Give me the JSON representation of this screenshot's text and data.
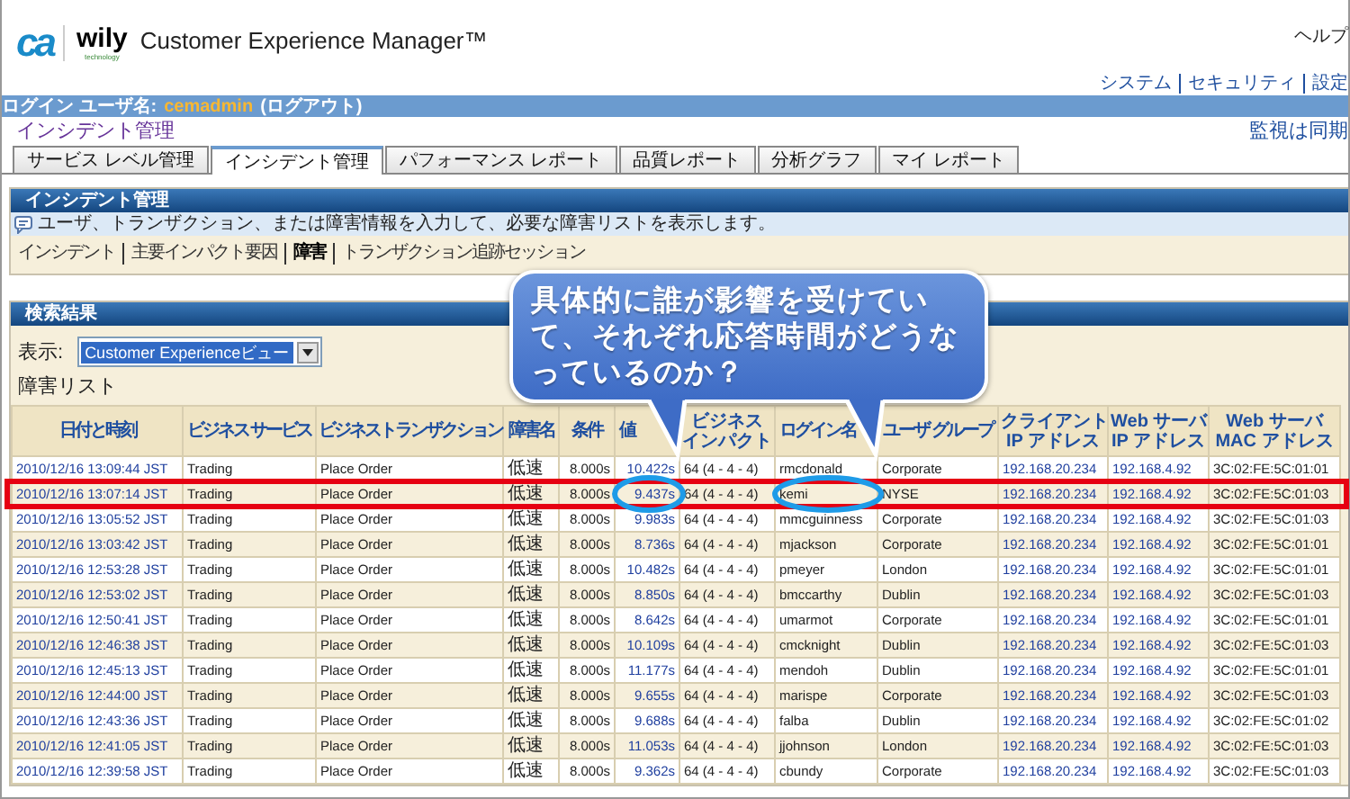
{
  "header": {
    "logo_mark": "ca",
    "logo_word": "wily",
    "logo_tagline": "technology",
    "product": "Customer Experience Manager™",
    "help_link": "ヘルプ",
    "links": [
      "システム",
      "セキュリティ",
      "設定"
    ]
  },
  "login_bar": {
    "label": "ログイン ユーザ名:",
    "user": "cemadmin",
    "logout": "(ログアウト)"
  },
  "page_title": "インシデント管理",
  "sync_status": "監視は同期",
  "tabs": [
    {
      "label": "サービス レベル管理",
      "selected": false
    },
    {
      "label": "インシデント管理",
      "selected": true
    },
    {
      "label": "パフォーマンス レポート",
      "selected": false
    },
    {
      "label": "品質レポート",
      "selected": false
    },
    {
      "label": "分析グラフ",
      "selected": false
    },
    {
      "label": "マイ レポート",
      "selected": false
    }
  ],
  "incident_section": {
    "title": "インシデント管理",
    "info": "ユーザ、トランザクション、または障害情報を入力して、必要な障害リストを表示します。",
    "links": [
      {
        "label": "インシデント",
        "selected": false
      },
      {
        "label": "主要インパクト要因",
        "selected": false
      },
      {
        "label": "障害",
        "selected": true
      },
      {
        "label": "トランザクション追跡セッション",
        "selected": false
      }
    ]
  },
  "results_section": {
    "title": "検索結果",
    "view_label": "表示:",
    "view_value": "Customer Experienceビュー",
    "list_title": "障害リスト"
  },
  "table": {
    "columns": [
      {
        "label": "日付と時刻",
        "kind": "link",
        "circled": false
      },
      {
        "label": "ビジネス サービス",
        "kind": "text",
        "circled": false
      },
      {
        "label": "ビジネストランザクション",
        "kind": "text",
        "circled": false
      },
      {
        "label": "障害名",
        "kind": "text",
        "circled": false
      },
      {
        "label": "条件",
        "kind": "text",
        "circled": false
      },
      {
        "label": "値",
        "kind": "link",
        "circled": true
      },
      {
        "label_lines": [
          "ビジネス",
          "インパクト"
        ],
        "kind": "text",
        "circled": false
      },
      {
        "label": "ログイン名",
        "kind": "text",
        "circled": true
      },
      {
        "label": "ユーザ グループ",
        "kind": "text",
        "circled": false
      },
      {
        "label_lines": [
          "クライアント",
          "IP アドレス"
        ],
        "kind": "link",
        "circled": false
      },
      {
        "label_lines": [
          "Web サーバ",
          "IP アドレス"
        ],
        "kind": "link",
        "circled": false
      },
      {
        "label_lines": [
          "Web サーバ",
          "MAC アドレス"
        ],
        "kind": "text",
        "circled": false
      }
    ],
    "rows": [
      {
        "highlighted": false,
        "cells": [
          "2010/12/16 13:09:44 JST",
          "Trading",
          "Place Order",
          "低速",
          "8.000s",
          "10.422s",
          "64 (4 - 4 - 4)",
          "rmcdonald",
          "Corporate",
          "192.168.20.234",
          "192.168.4.92",
          "3C:02:FE:5C:01:01"
        ]
      },
      {
        "highlighted": true,
        "cells": [
          "2010/12/16 13:07:14 JST",
          "Trading",
          "Place Order",
          "低速",
          "8.000s",
          "9.437s",
          "64 (4 - 4 - 4)",
          "kemi",
          "NYSE",
          "192.168.20.234",
          "192.168.4.92",
          "3C:02:FE:5C:01:03"
        ]
      },
      {
        "highlighted": false,
        "cells": [
          "2010/12/16 13:05:52 JST",
          "Trading",
          "Place Order",
          "低速",
          "8.000s",
          "9.983s",
          "64 (4 - 4 - 4)",
          "mmcguinness",
          "Corporate",
          "192.168.20.234",
          "192.168.4.92",
          "3C:02:FE:5C:01:03"
        ]
      },
      {
        "highlighted": false,
        "cells": [
          "2010/12/16 13:03:42 JST",
          "Trading",
          "Place Order",
          "低速",
          "8.000s",
          "8.736s",
          "64 (4 - 4 - 4)",
          "mjackson",
          "Corporate",
          "192.168.20.234",
          "192.168.4.92",
          "3C:02:FE:5C:01:01"
        ]
      },
      {
        "highlighted": false,
        "cells": [
          "2010/12/16 12:53:28 JST",
          "Trading",
          "Place Order",
          "低速",
          "8.000s",
          "10.482s",
          "64 (4 - 4 - 4)",
          "pmeyer",
          "London",
          "192.168.20.234",
          "192.168.4.92",
          "3C:02:FE:5C:01:01"
        ]
      },
      {
        "highlighted": false,
        "cells": [
          "2010/12/16 12:53:02 JST",
          "Trading",
          "Place Order",
          "低速",
          "8.000s",
          "8.850s",
          "64 (4 - 4 - 4)",
          "bmccarthy",
          "Dublin",
          "192.168.20.234",
          "192.168.4.92",
          "3C:02:FE:5C:01:03"
        ]
      },
      {
        "highlighted": false,
        "cells": [
          "2010/12/16 12:50:41 JST",
          "Trading",
          "Place Order",
          "低速",
          "8.000s",
          "8.642s",
          "64 (4 - 4 - 4)",
          "umarmot",
          "Corporate",
          "192.168.20.234",
          "192.168.4.92",
          "3C:02:FE:5C:01:01"
        ]
      },
      {
        "highlighted": false,
        "cells": [
          "2010/12/16 12:46:38 JST",
          "Trading",
          "Place Order",
          "低速",
          "8.000s",
          "10.109s",
          "64 (4 - 4 - 4)",
          "cmcknight",
          "Dublin",
          "192.168.20.234",
          "192.168.4.92",
          "3C:02:FE:5C:01:03"
        ]
      },
      {
        "highlighted": false,
        "cells": [
          "2010/12/16 12:45:13 JST",
          "Trading",
          "Place Order",
          "低速",
          "8.000s",
          "11.177s",
          "64 (4 - 4 - 4)",
          "mendoh",
          "Dublin",
          "192.168.20.234",
          "192.168.4.92",
          "3C:02:FE:5C:01:01"
        ]
      },
      {
        "highlighted": false,
        "cells": [
          "2010/12/16 12:44:00 JST",
          "Trading",
          "Place Order",
          "低速",
          "8.000s",
          "9.655s",
          "64 (4 - 4 - 4)",
          "marispe",
          "Corporate",
          "192.168.20.234",
          "192.168.4.92",
          "3C:02:FE:5C:01:03"
        ]
      },
      {
        "highlighted": false,
        "cells": [
          "2010/12/16 12:43:36 JST",
          "Trading",
          "Place Order",
          "低速",
          "8.000s",
          "9.688s",
          "64 (4 - 4 - 4)",
          "falba",
          "Dublin",
          "192.168.20.234",
          "192.168.4.92",
          "3C:02:FE:5C:01:02"
        ]
      },
      {
        "highlighted": false,
        "cells": [
          "2010/12/16 12:41:05 JST",
          "Trading",
          "Place Order",
          "低速",
          "8.000s",
          "11.053s",
          "64 (4 - 4 - 4)",
          "jjohnson",
          "London",
          "192.168.20.234",
          "192.168.4.92",
          "3C:02:FE:5C:01:03"
        ]
      },
      {
        "highlighted": false,
        "cells": [
          "2010/12/16 12:39:58 JST",
          "Trading",
          "Place Order",
          "低速",
          "8.000s",
          "9.362s",
          "64 (4 - 4 - 4)",
          "cbundy",
          "Corporate",
          "192.168.20.234",
          "192.168.4.92",
          "3C:02:FE:5C:01:03"
        ]
      }
    ]
  },
  "callout": {
    "text": "具体的に誰が影響を受けていて、それぞれ応答時間がどうなっているのか？"
  }
}
